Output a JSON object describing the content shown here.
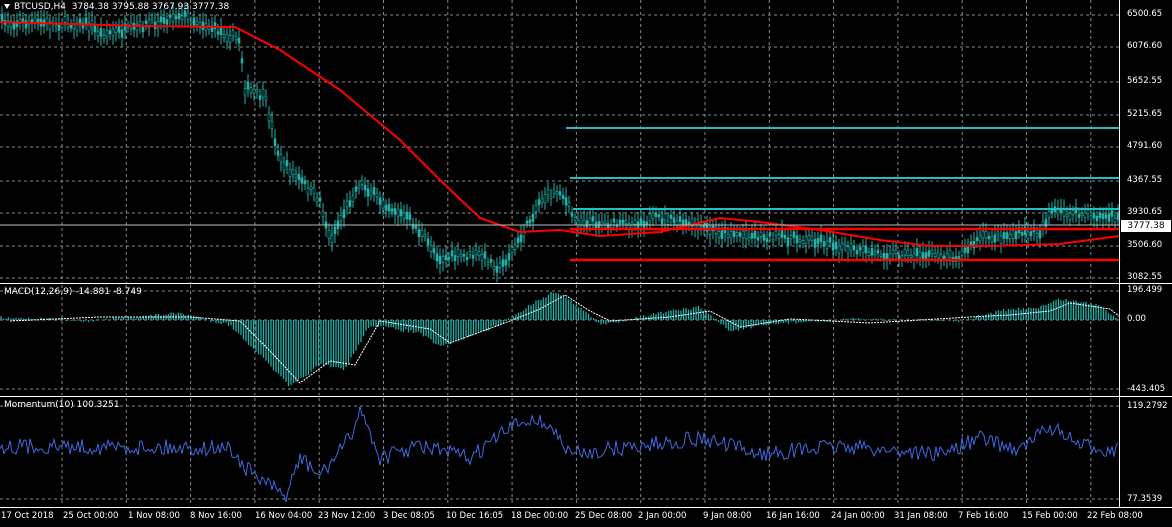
{
  "header": {
    "symbol_timeframe": "BTCUSD,H4",
    "ohlc": "3784.38 3795.88 3767.93 3777.38"
  },
  "price_pane": {
    "current_price": "3777.38",
    "y_labels": [
      "6500.65",
      "6076.60",
      "5652.55",
      "5215.65",
      "4791.60",
      "4367.55",
      "3930.65",
      "3506.60",
      "3082.55"
    ],
    "colors": {
      "candles": "#20b2aa",
      "ma": "#ff0000",
      "levels_cyan": "#20c0c0",
      "levels_red": "#ff0000"
    }
  },
  "macd_pane": {
    "label": "MACD(12,26,9) -14.881 -8.749",
    "y_labels": [
      "196.499",
      "0.00",
      "-443.405"
    ],
    "colors": {
      "histogram": "#20b2aa",
      "signal": "#ffffff"
    }
  },
  "momentum_pane": {
    "label": "Momentum(10) 100.3251",
    "y_labels": [
      "119.2792",
      "77.3539"
    ],
    "colors": {
      "line": "#4169e1"
    }
  },
  "x_axis": {
    "labels": [
      "17 Oct 2018",
      "25 Oct 00:00",
      "1 Nov 08:00",
      "8 Nov 16:00",
      "16 Nov 04:00",
      "23 Nov 12:00",
      "3 Dec 08:05",
      "10 Dec 16:05",
      "18 Dec 00:00",
      "25 Dec 08:00",
      "2 Jan 00:00",
      "9 Jan 08:00",
      "16 Jan 16:00",
      "24 Jan 00:00",
      "31 Jan 08:00",
      "7 Feb 16:00",
      "15 Feb 00:00",
      "22 Feb 08:00"
    ]
  }
}
